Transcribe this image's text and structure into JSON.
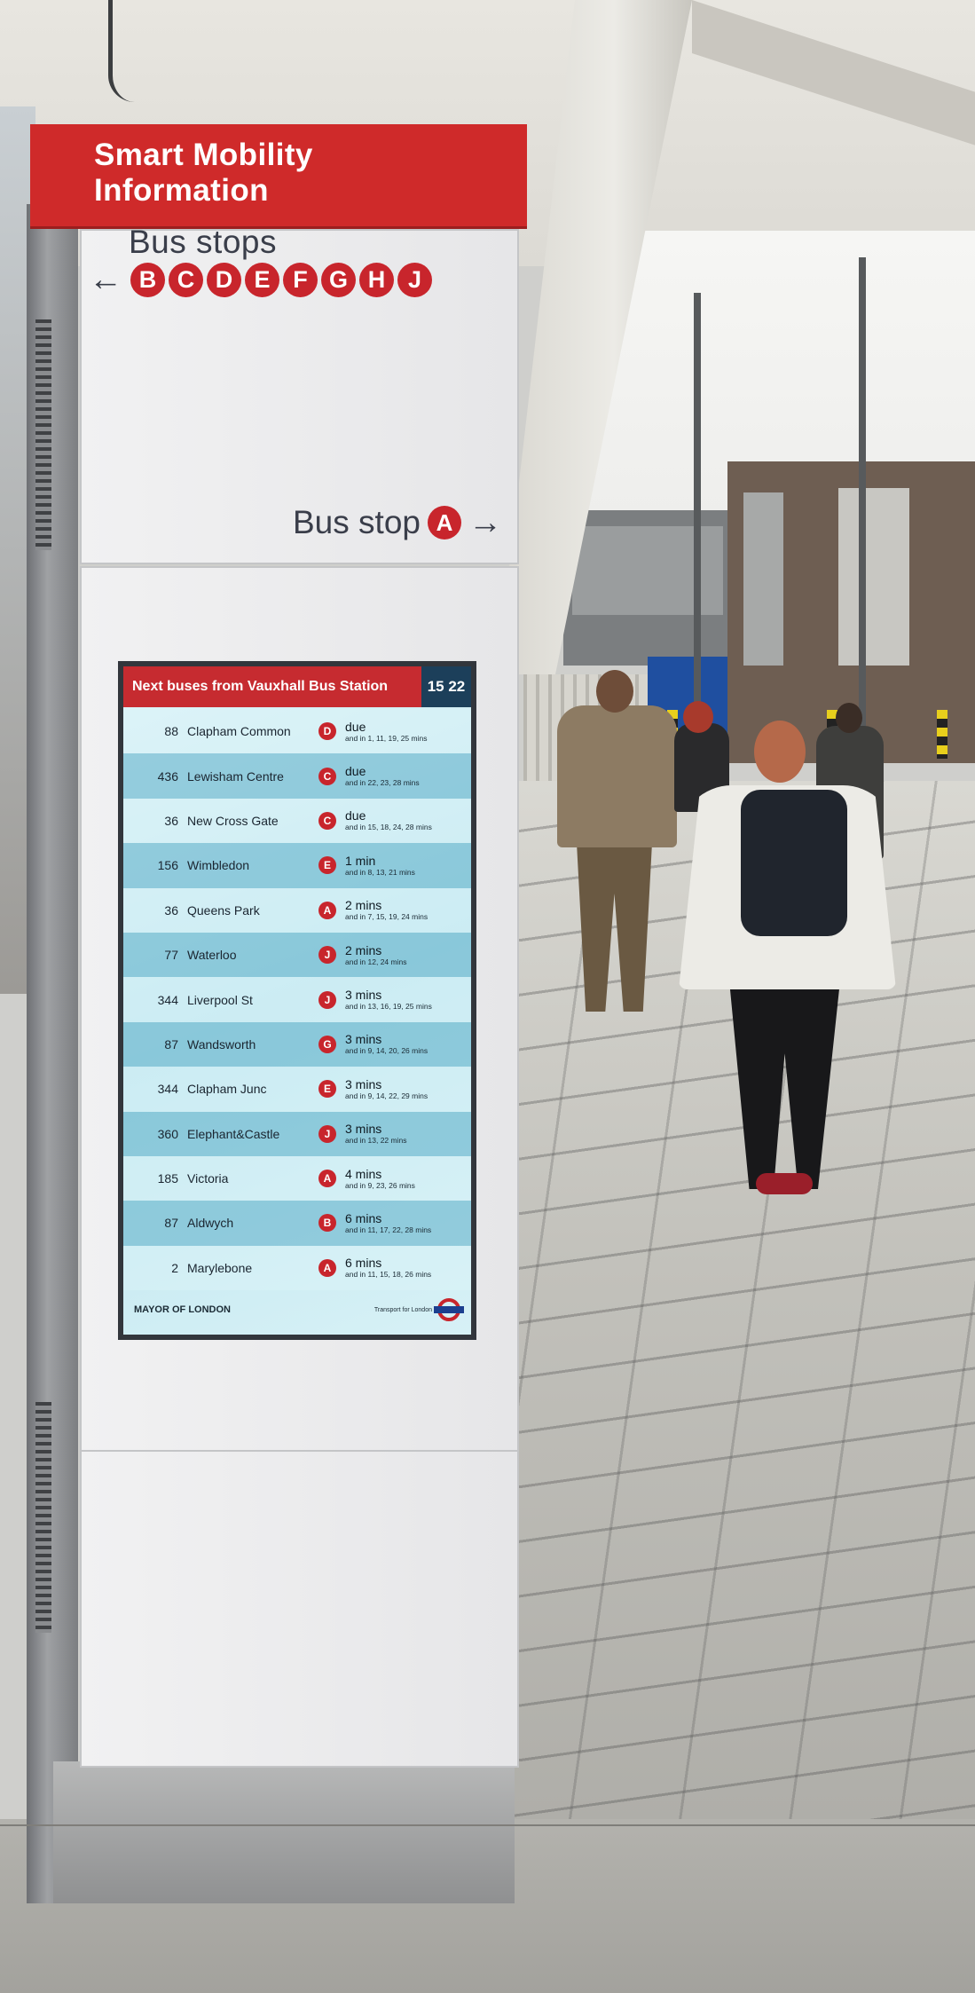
{
  "sign": {
    "header_line1": "Smart Mobility",
    "header_line2": "Information",
    "bus_stops_title": "Bus stops",
    "left_arrow": "←",
    "right_arrow": "→",
    "stops_left": [
      "B",
      "C",
      "D",
      "E",
      "F",
      "G",
      "H",
      "J"
    ],
    "stop_right_label": "Bus stop",
    "stop_right_letter": "A"
  },
  "screen": {
    "title": "Next buses from Vauxhall Bus Station",
    "time": "15 22",
    "rows": [
      {
        "route": "88",
        "destination": "Clapham Common",
        "stop": "D",
        "next": "due",
        "later": "and in 1, 11, 19, 25 mins"
      },
      {
        "route": "436",
        "destination": "Lewisham Centre",
        "stop": "C",
        "next": "due",
        "later": "and in 22, 23, 28 mins"
      },
      {
        "route": "36",
        "destination": "New Cross Gate",
        "stop": "C",
        "next": "due",
        "later": "and in 15, 18, 24, 28 mins"
      },
      {
        "route": "156",
        "destination": "Wimbledon",
        "stop": "E",
        "next": "1 min",
        "later": "and in 8, 13, 21 mins"
      },
      {
        "route": "36",
        "destination": "Queens Park",
        "stop": "A",
        "next": "2 mins",
        "later": "and in 7, 15, 19, 24 mins"
      },
      {
        "route": "77",
        "destination": "Waterloo",
        "stop": "J",
        "next": "2 mins",
        "later": "and in 12, 24 mins"
      },
      {
        "route": "344",
        "destination": "Liverpool St",
        "stop": "J",
        "next": "3 mins",
        "later": "and in 13, 16, 19, 25 mins"
      },
      {
        "route": "87",
        "destination": "Wandsworth",
        "stop": "G",
        "next": "3 mins",
        "later": "and in 9, 14, 20, 26 mins"
      },
      {
        "route": "344",
        "destination": "Clapham Junc",
        "stop": "E",
        "next": "3 mins",
        "later": "and in 9, 14, 22, 29 mins"
      },
      {
        "route": "360",
        "destination": "Elephant&Castle",
        "stop": "J",
        "next": "3 mins",
        "later": "and in 13, 22 mins"
      },
      {
        "route": "185",
        "destination": "Victoria",
        "stop": "A",
        "next": "4 mins",
        "later": "and in 9, 23, 26 mins"
      },
      {
        "route": "87",
        "destination": "Aldwych",
        "stop": "B",
        "next": "6 mins",
        "later": "and in 11, 17, 22, 28 mins"
      },
      {
        "route": "2",
        "destination": "Marylebone",
        "stop": "A",
        "next": "6 mins",
        "later": "and in 11, 15, 18, 26 mins"
      }
    ],
    "footer_left": "MAYOR OF LONDON",
    "footer_right": "Transport for London"
  },
  "colors": {
    "header_red": "#cf2a2a",
    "stop_badge_red": "#c8252c",
    "screen_title_red": "#c62b30",
    "time_box_navy": "#1c3f5a",
    "screen_row_blue": "#5dafc8"
  }
}
